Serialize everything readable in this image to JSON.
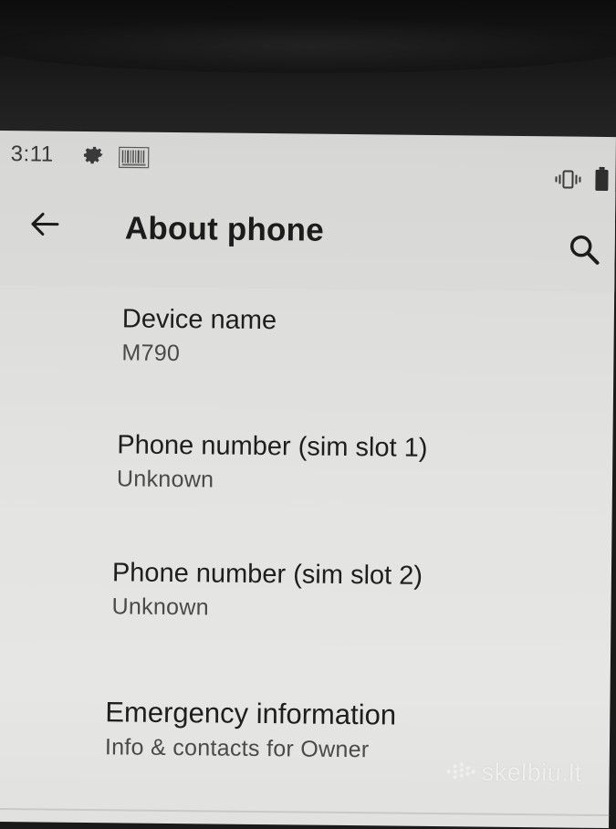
{
  "status_bar": {
    "time": "3:11",
    "icons": [
      "gear-icon",
      "barcode-icon",
      "vibrate-icon",
      "battery-icon"
    ]
  },
  "app_bar": {
    "title": "About phone",
    "back_icon": "back-arrow-icon",
    "search_icon": "search-icon"
  },
  "settings": {
    "items": [
      {
        "title": "Device name",
        "summary": "M790"
      },
      {
        "title": "Phone number (sim slot 1)",
        "summary": "Unknown"
      },
      {
        "title": "Phone number (sim slot 2)",
        "summary": "Unknown"
      },
      {
        "title": "Emergency information",
        "summary": "Info & contacts for Owner"
      }
    ]
  },
  "watermark": {
    "text": "skelbiu.lt"
  },
  "colors": {
    "screen_background": "#e3e3e1",
    "title_text": "#1c1c1c",
    "summary_text": "#4a4a4a",
    "bezel": "#1a1a1a"
  }
}
